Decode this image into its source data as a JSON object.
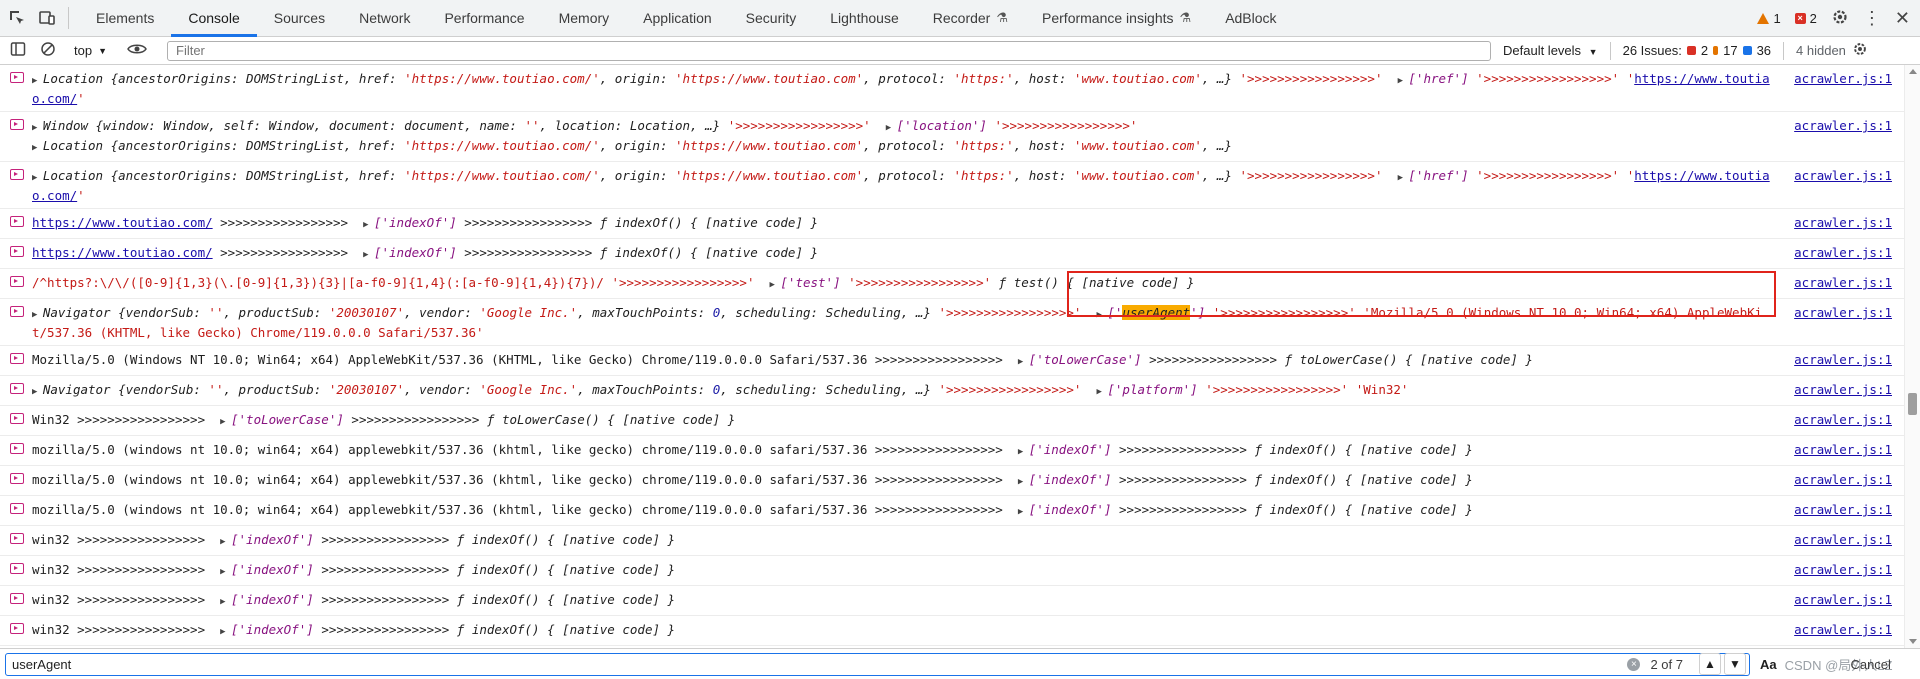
{
  "tabs": [
    "Elements",
    "Console",
    "Sources",
    "Network",
    "Performance",
    "Memory",
    "Application",
    "Security",
    "Lighthouse",
    "Recorder",
    "Performance insights",
    "AdBlock"
  ],
  "active_tab": "Console",
  "top_warnings": "1",
  "top_errors": "2",
  "toolbar": {
    "context": "top",
    "filter_placeholder": "Filter",
    "levels": "Default levels",
    "issues_label": "26 Issues:",
    "issues_errors": "2",
    "issues_warnings": "17",
    "issues_info": "36",
    "hidden": "4 hidden"
  },
  "source_link": "acrawler.js:1",
  "arrows": ">>>>>>>>>>>>>>>>>",
  "search": {
    "query": "userAgent",
    "count": "2 of 7",
    "aa": "Aa",
    "cancel": "Cancel",
    "watermark": "CSDN @局外人LZ"
  },
  "rows": [
    {
      "parts": [
        [
          "tri",
          "▶ "
        ],
        [
          "i",
          "Location "
        ],
        [
          "i",
          "{ancestorOrigins: DOMStringList, href: "
        ],
        [
          "si",
          "'https://www.toutiao.com/'"
        ],
        [
          "i",
          ", origin: "
        ],
        [
          "si",
          "'https://www.toutiao.com'"
        ],
        [
          "i",
          ", protocol: "
        ],
        [
          "si",
          "'https:'"
        ],
        [
          "i",
          ", host: "
        ],
        [
          "si",
          "'www.toutiao.com'"
        ],
        [
          "i",
          ", …} "
        ],
        [
          "s",
          "'>>>>>>>>>>>>>>>>>'"
        ],
        [
          "t",
          "  "
        ],
        [
          "tri",
          "▶ "
        ],
        [
          "k",
          "['href']"
        ],
        [
          "t",
          " "
        ],
        [
          "s",
          "'>>>>>>>>>>>>>>>>>'"
        ],
        [
          "t",
          " "
        ],
        [
          "s",
          "'"
        ],
        [
          "u",
          "https://www.toutiao.com/"
        ],
        [
          "s",
          "'"
        ]
      ]
    },
    {
      "parts": [
        [
          "tri",
          "▶ "
        ],
        [
          "i",
          "Window {window: Window, self: Window, document: document, name: "
        ],
        [
          "si",
          "''"
        ],
        [
          "i",
          ", location: Location, …} "
        ],
        [
          "s",
          "'>>>>>>>>>>>>>>>>>'"
        ],
        [
          "t",
          "  "
        ],
        [
          "tri",
          "▶ "
        ],
        [
          "k",
          "['location']"
        ],
        [
          "t",
          " "
        ],
        [
          "s",
          "'>>>>>>>>>>>>>>>>>'"
        ],
        [
          "br",
          ""
        ],
        [
          "tri",
          "▶ "
        ],
        [
          "i",
          "Location {ancestorOrigins: DOMStringList, href: "
        ],
        [
          "si",
          "'https://www.toutiao.com/'"
        ],
        [
          "i",
          ", origin: "
        ],
        [
          "si",
          "'https://www.toutiao.com'"
        ],
        [
          "i",
          ", protocol: "
        ],
        [
          "si",
          "'https:'"
        ],
        [
          "i",
          ", host: "
        ],
        [
          "si",
          "'www.toutiao.com'"
        ],
        [
          "i",
          ", …}"
        ]
      ]
    },
    {
      "parts": [
        [
          "tri",
          "▶ "
        ],
        [
          "i",
          "Location {ancestorOrigins: DOMStringList, href: "
        ],
        [
          "si",
          "'https://www.toutiao.com/'"
        ],
        [
          "i",
          ", origin: "
        ],
        [
          "si",
          "'https://www.toutiao.com'"
        ],
        [
          "i",
          ", protocol: "
        ],
        [
          "si",
          "'https:'"
        ],
        [
          "i",
          ", host: "
        ],
        [
          "si",
          "'www.toutiao.com'"
        ],
        [
          "i",
          ", …} "
        ],
        [
          "s",
          "'>>>>>>>>>>>>>>>>>'"
        ],
        [
          "t",
          "  "
        ],
        [
          "tri",
          "▶ "
        ],
        [
          "k",
          "['href']"
        ],
        [
          "t",
          " "
        ],
        [
          "s",
          "'>>>>>>>>>>>>>>>>>'"
        ],
        [
          "t",
          " "
        ],
        [
          "s",
          "'"
        ],
        [
          "u",
          "https://www.toutiao.com/"
        ],
        [
          "s",
          "'"
        ]
      ]
    },
    {
      "parts": [
        [
          "u",
          "https://www.toutiao.com/"
        ],
        [
          "t",
          " >>>>>>>>>>>>>>>>>  "
        ],
        [
          "tri",
          "▶ "
        ],
        [
          "k",
          "['indexOf']"
        ],
        [
          "t",
          " >>>>>>>>>>>>>>>>> "
        ],
        [
          "i",
          "ƒ indexOf() { [native code] }"
        ]
      ]
    },
    {
      "parts": [
        [
          "u",
          "https://www.toutiao.com/"
        ],
        [
          "t",
          " >>>>>>>>>>>>>>>>>  "
        ],
        [
          "tri",
          "▶ "
        ],
        [
          "k",
          "['indexOf']"
        ],
        [
          "t",
          " >>>>>>>>>>>>>>>>> "
        ],
        [
          "i",
          "ƒ indexOf() { [native code] }"
        ]
      ]
    },
    {
      "parts": [
        [
          "s",
          "/^https?:\\/\\/([0-9]{1,3}(\\.[0-9]{1,3}){3}|[a-f0-9]{1,4}(:[a-f0-9]{1,4}){7})/"
        ],
        [
          "t",
          " "
        ],
        [
          "s",
          "'>>>>>>>>>>>>>>>>>'"
        ],
        [
          "t",
          "  "
        ],
        [
          "tri",
          "▶ "
        ],
        [
          "k",
          "['test']"
        ],
        [
          "t",
          " "
        ],
        [
          "s",
          "'>>>>>>>>>>>>>>>>>'"
        ],
        [
          "t",
          " "
        ],
        [
          "i",
          "ƒ test() { [native code] }"
        ]
      ]
    },
    {
      "parts": [
        [
          "tri",
          "▶ "
        ],
        [
          "i",
          "Navigator {vendorSub: "
        ],
        [
          "si",
          "''"
        ],
        [
          "i",
          ", productSub: "
        ],
        [
          "si",
          "'20030107'"
        ],
        [
          "i",
          ", vendor: "
        ],
        [
          "si",
          "'Google Inc.'"
        ],
        [
          "i",
          ", maxTouchPoints: "
        ],
        [
          "ni",
          "0"
        ],
        [
          "i",
          ", scheduling: Scheduling, …} "
        ],
        [
          "s",
          "'>>>>>>>>>>>>>>>>>'"
        ],
        [
          "t",
          "  "
        ],
        [
          "tri",
          "▶ "
        ],
        [
          "k",
          "['"
        ],
        [
          "hl",
          "userAgent"
        ],
        [
          "k",
          "']"
        ],
        [
          "t",
          " "
        ],
        [
          "s",
          "'>>>>>>>>>>>>>>>>>'"
        ],
        [
          "t",
          " "
        ],
        [
          "s",
          "'Mozilla/5.0 (Windows NT 10.0; Win64; x64) AppleWebKit/537.36 (KHTML, like Gecko) Chrome/119.0.0.0 Safari/537.36'"
        ]
      ]
    },
    {
      "parts": [
        [
          "t",
          "Mozilla/5.0 (Windows NT 10.0; Win64; x64) AppleWebKit/537.36 (KHTML, like Gecko) Chrome/119.0.0.0 Safari/537.36 >>>>>>>>>>>>>>>>>  "
        ],
        [
          "tri",
          "▶ "
        ],
        [
          "k",
          "['toLowerCase']"
        ],
        [
          "t",
          " >>>>>>>>>>>>>>>>> "
        ],
        [
          "i",
          "ƒ toLowerCase() { [native code] }"
        ]
      ]
    },
    {
      "parts": [
        [
          "tri",
          "▶ "
        ],
        [
          "i",
          "Navigator {vendorSub: "
        ],
        [
          "si",
          "''"
        ],
        [
          "i",
          ", productSub: "
        ],
        [
          "si",
          "'20030107'"
        ],
        [
          "i",
          ", vendor: "
        ],
        [
          "si",
          "'Google Inc.'"
        ],
        [
          "i",
          ", maxTouchPoints: "
        ],
        [
          "ni",
          "0"
        ],
        [
          "i",
          ", scheduling: Scheduling, …} "
        ],
        [
          "s",
          "'>>>>>>>>>>>>>>>>>'"
        ],
        [
          "t",
          "  "
        ],
        [
          "tri",
          "▶ "
        ],
        [
          "k",
          "['platform']"
        ],
        [
          "t",
          " "
        ],
        [
          "s",
          "'>>>>>>>>>>>>>>>>>'"
        ],
        [
          "t",
          " "
        ],
        [
          "s",
          "'Win32'"
        ]
      ]
    },
    {
      "parts": [
        [
          "t",
          "Win32 >>>>>>>>>>>>>>>>>  "
        ],
        [
          "tri",
          "▶ "
        ],
        [
          "k",
          "['toLowerCase']"
        ],
        [
          "t",
          " >>>>>>>>>>>>>>>>> "
        ],
        [
          "i",
          "ƒ toLowerCase() { [native code] }"
        ]
      ]
    },
    {
      "parts": [
        [
          "t",
          "mozilla/5.0 (windows nt 10.0; win64; x64) applewebkit/537.36 (khtml, like gecko) chrome/119.0.0.0 safari/537.36 >>>>>>>>>>>>>>>>>  "
        ],
        [
          "tri",
          "▶ "
        ],
        [
          "k",
          "['indexOf']"
        ],
        [
          "t",
          " >>>>>>>>>>>>>>>>> "
        ],
        [
          "i",
          "ƒ indexOf() { [native code] }"
        ]
      ]
    },
    {
      "parts": [
        [
          "t",
          "mozilla/5.0 (windows nt 10.0; win64; x64) applewebkit/537.36 (khtml, like gecko) chrome/119.0.0.0 safari/537.36 >>>>>>>>>>>>>>>>>  "
        ],
        [
          "tri",
          "▶ "
        ],
        [
          "k",
          "['indexOf']"
        ],
        [
          "t",
          " >>>>>>>>>>>>>>>>> "
        ],
        [
          "i",
          "ƒ indexOf() { [native code] }"
        ]
      ]
    },
    {
      "parts": [
        [
          "t",
          "mozilla/5.0 (windows nt 10.0; win64; x64) applewebkit/537.36 (khtml, like gecko) chrome/119.0.0.0 safari/537.36 >>>>>>>>>>>>>>>>>  "
        ],
        [
          "tri",
          "▶ "
        ],
        [
          "k",
          "['indexOf']"
        ],
        [
          "t",
          " >>>>>>>>>>>>>>>>> "
        ],
        [
          "i",
          "ƒ indexOf() { [native code] }"
        ]
      ]
    },
    {
      "parts": [
        [
          "t",
          "win32 >>>>>>>>>>>>>>>>>  "
        ],
        [
          "tri",
          "▶ "
        ],
        [
          "k",
          "['indexOf']"
        ],
        [
          "t",
          " >>>>>>>>>>>>>>>>> "
        ],
        [
          "i",
          "ƒ indexOf() { [native code] }"
        ]
      ]
    },
    {
      "parts": [
        [
          "t",
          "win32 >>>>>>>>>>>>>>>>>  "
        ],
        [
          "tri",
          "▶ "
        ],
        [
          "k",
          "['indexOf']"
        ],
        [
          "t",
          " >>>>>>>>>>>>>>>>> "
        ],
        [
          "i",
          "ƒ indexOf() { [native code] }"
        ]
      ]
    },
    {
      "parts": [
        [
          "t",
          "win32 >>>>>>>>>>>>>>>>>  "
        ],
        [
          "tri",
          "▶ "
        ],
        [
          "k",
          "['indexOf']"
        ],
        [
          "t",
          " >>>>>>>>>>>>>>>>> "
        ],
        [
          "i",
          "ƒ indexOf() { [native code] }"
        ]
      ]
    },
    {
      "parts": [
        [
          "t",
          "win32 >>>>>>>>>>>>>>>>>  "
        ],
        [
          "tri",
          "▶ "
        ],
        [
          "k",
          "['indexOf']"
        ],
        [
          "t",
          " >>>>>>>>>>>>>>>>> "
        ],
        [
          "i",
          "ƒ indexOf() { [native code] }"
        ]
      ]
    },
    {
      "parts": [
        [
          "t",
          "win32 >>>>>>>>>>>>>>>>>  "
        ],
        [
          "tri",
          "▶ "
        ],
        [
          "k",
          "['indexOf']"
        ],
        [
          "t",
          " >>>>>>>>>>>>>>>>> "
        ],
        [
          "i",
          "ƒ indexOf() { [native code] }"
        ]
      ]
    },
    {
      "parts": [
        [
          "t",
          "win32 >>>>>>>>>>>>>>>>>  "
        ],
        [
          "tri",
          "▶ "
        ],
        [
          "k",
          "['indexOf']"
        ],
        [
          "t",
          " >>>>>>>>>>>>>>>>> "
        ],
        [
          "i",
          "ƒ indexOf() { [native code] }"
        ]
      ]
    }
  ]
}
